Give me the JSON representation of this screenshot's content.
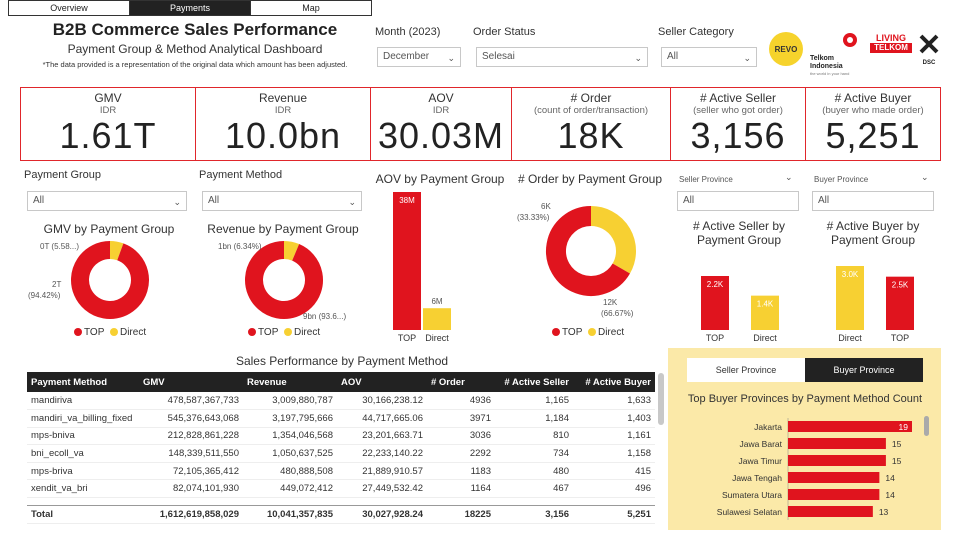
{
  "tabs": [
    {
      "label": "Overview",
      "active": false
    },
    {
      "label": "Payments",
      "active": true
    },
    {
      "label": "Map",
      "active": false
    }
  ],
  "header": {
    "title": "B2B Commerce Sales Performance",
    "subtitle": "Payment Group & Method Analytical Dashboard",
    "note": "*The data provided is a representation of the original data which amount has been adjusted."
  },
  "filters": {
    "month": {
      "label": "Month (2023)",
      "value": "December"
    },
    "order_status": {
      "label": "Order Status",
      "value": "Selesai"
    },
    "seller_category": {
      "label": "Seller Category",
      "value": "All"
    },
    "payment_group": {
      "label": "Payment Group",
      "value": "All"
    },
    "payment_method": {
      "label": "Payment Method",
      "value": "All"
    },
    "seller_province": {
      "label": "Seller Province",
      "value": "All"
    },
    "buyer_province": {
      "label": "Buyer Province",
      "value": "All"
    }
  },
  "logos": {
    "revo": "REVO",
    "telkom": "Telkom Indonesia",
    "telkom_tag": "the world in your hand",
    "living": "LIVING",
    "living2": "TELKOM",
    "dsc": "DSC"
  },
  "kpis": [
    {
      "title": "GMV",
      "sub": "IDR",
      "value": "1.61T"
    },
    {
      "title": "Revenue",
      "sub": "IDR",
      "value": "10.0bn"
    },
    {
      "title": "AOV",
      "sub": "IDR",
      "value": "30.03M"
    },
    {
      "title": "# Order",
      "sub": "(count of order/transaction)",
      "value": "18K"
    },
    {
      "title": "# Active Seller",
      "sub": "(seller who got order)",
      "value": "3,156"
    },
    {
      "title": "# Active Buyer",
      "sub": "(buyer who made order)",
      "value": "5,251"
    }
  ],
  "colors": {
    "top": "#e0141e",
    "direct": "#f7d032",
    "dark": "#222222",
    "accent": "#e0262b"
  },
  "legend": {
    "top": "TOP",
    "direct": "Direct"
  },
  "chart_data": [
    {
      "type": "pie",
      "title": "GMV by Payment Group",
      "categories": [
        "TOP",
        "Direct"
      ],
      "values": [
        94.42,
        5.58
      ],
      "labels": [
        "2T (94.42%)",
        "0T (5.58...)"
      ],
      "label_top": "2T",
      "label_top_pct": "(94.42%)",
      "label_direct": "0T (5.58...)"
    },
    {
      "type": "pie",
      "title": "Revenue by Payment Group",
      "categories": [
        "TOP",
        "Direct"
      ],
      "values": [
        93.66,
        6.34
      ],
      "label_top": "9bn (93.6...)",
      "label_direct": "1bn (6.34%)"
    },
    {
      "type": "bar",
      "title": "AOV by Payment Group",
      "categories": [
        "TOP",
        "Direct"
      ],
      "values": [
        38,
        6
      ],
      "data_labels": [
        "38M",
        "6M"
      ]
    },
    {
      "type": "pie",
      "title": "# Order by Payment Group",
      "categories": [
        "TOP",
        "Direct"
      ],
      "values": [
        66.67,
        33.33
      ],
      "label_top": "12K",
      "label_top_pct": "(66.67%)",
      "label_direct": "6K",
      "label_direct_pct": "(33.33%)"
    },
    {
      "type": "bar",
      "title": "# Active Seller by Payment Group",
      "categories": [
        "TOP",
        "Direct"
      ],
      "values": [
        2.2,
        1.4
      ],
      "data_labels": [
        "2.2K",
        "1.4K"
      ]
    },
    {
      "type": "bar",
      "title": "# Active Buyer by Payment Group",
      "categories": [
        "Direct",
        "TOP"
      ],
      "values": [
        3.0,
        2.5
      ],
      "data_labels": [
        "3.0K",
        "2.5K"
      ]
    },
    {
      "type": "bar",
      "title": "Top Buyer Provinces by Payment Method Count",
      "categories": [
        "Jakarta",
        "Jawa Barat",
        "Jawa Timur",
        "Jawa Tengah",
        "Sumatera Utara",
        "Sulawesi Selatan"
      ],
      "values": [
        19,
        15,
        15,
        14,
        14,
        13
      ],
      "orientation": "horizontal"
    }
  ],
  "province_tabs": [
    {
      "label": "Seller Province",
      "active": false
    },
    {
      "label": "Buyer Province",
      "active": true
    }
  ],
  "table": {
    "title": "Sales Performance by Payment Method",
    "columns": [
      "Payment Method",
      "GMV",
      "Revenue",
      "AOV",
      "# Order",
      "# Active Seller",
      "# Active Buyer"
    ],
    "rows": [
      [
        "mandiriva",
        "478,587,367,733",
        "3,009,880,787",
        "30,166,238.12",
        "4936",
        "1,165",
        "1,633"
      ],
      [
        "mandiri_va_billing_fixed",
        "545,376,643,068",
        "3,197,795,666",
        "44,717,665.06",
        "3971",
        "1,184",
        "1,403"
      ],
      [
        "mps-bniva",
        "212,828,861,228",
        "1,354,046,568",
        "23,201,663.71",
        "3036",
        "810",
        "1,161"
      ],
      [
        "bni_ecoll_va",
        "148,339,511,550",
        "1,050,637,525",
        "22,233,140.22",
        "2292",
        "734",
        "1,158"
      ],
      [
        "mps-briva",
        "72,105,365,412",
        "480,888,508",
        "21,889,910.57",
        "1183",
        "480",
        "415"
      ],
      [
        "xendit_va_bri",
        "82,074,101,930",
        "449,072,412",
        "27,449,532.42",
        "1164",
        "467",
        "496"
      ]
    ],
    "total": [
      "Total",
      "1,612,619,858,029",
      "10,041,357,835",
      "30,027,928.24",
      "18225",
      "3,156",
      "5,251"
    ]
  }
}
